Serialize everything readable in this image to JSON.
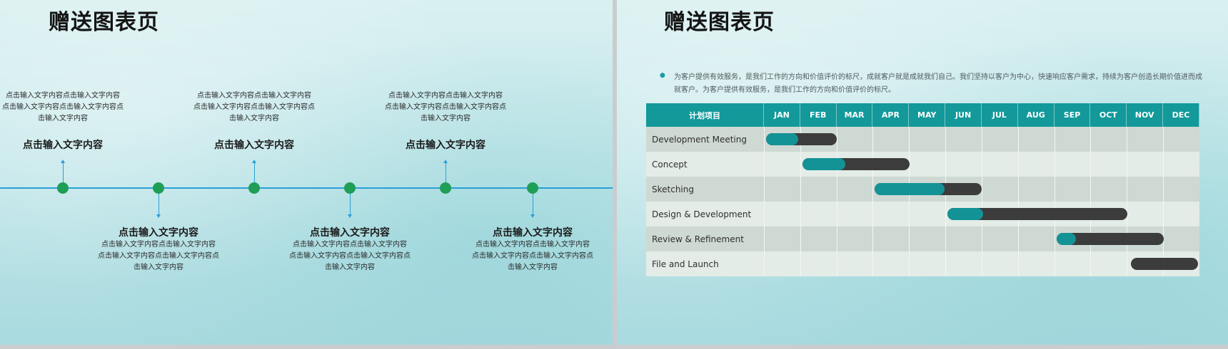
{
  "left_slide": {
    "title": "赠送图表页",
    "milestones": [
      {
        "heading": "点击输入文字内容",
        "desc": [
          "点击输入文字内容点击输入文字内容",
          "点击输入文字内容点击输入文字内容点",
          "击输入文字内容"
        ],
        "side": "top"
      },
      {
        "heading": "点击输入文字内容",
        "desc": [
          "点击输入文字内容点击输入文字内容",
          "点击输入文字内容点击输入文字内容点",
          "击输入文字内容"
        ],
        "side": "bottom"
      },
      {
        "heading": "点击输入文字内容",
        "desc": [
          "点击输入文字内容点击输入文字内容",
          "点击输入文字内容点击输入文字内容点",
          "击输入文字内容"
        ],
        "side": "top"
      },
      {
        "heading": "点击输入文字内容",
        "desc": [
          "点击输入文字内容点击输入文字内容",
          "点击输入文字内容点击输入文字内容点",
          "击输入文字内容"
        ],
        "side": "bottom"
      },
      {
        "heading": "点击输入文字内容",
        "desc": [
          "点击输入文字内容点击输入文字内容",
          "点击输入文字内容点击输入文字内容点",
          "击输入文字内容"
        ],
        "side": "top"
      },
      {
        "heading": "点击输入文字内容",
        "desc": [
          "点击输入文字内容点击输入文字内容",
          "点击输入文字内容点击输入文字内容点",
          "击输入文字内容"
        ],
        "side": "bottom"
      }
    ],
    "colors": {
      "line": "#2a9fd6",
      "dot": "#1f9e55"
    }
  },
  "right_slide": {
    "title": "赠送图表页",
    "intro": "为客户提供有效服务，是我们工作的方向和价值评价的标尺，成就客户就是成就我们自己。我们坚持以客户为中心，快速响应客户需求，持续为客户创造长期价值进而成就客户。为客户提供有效服务，是我们工作的方向和价值评价的标尺。",
    "gantt": {
      "header_label": "计划项目",
      "months": [
        "JAN",
        "FEB",
        "MAR",
        "APR",
        "MAY",
        "JUN",
        "JUL",
        "AUG",
        "SEP",
        "OCT",
        "NOV",
        "DEC"
      ],
      "tasks": [
        {
          "name": "Development Meeting",
          "start": 0,
          "end": 1.95,
          "progress": 0.45
        },
        {
          "name": "Concept",
          "start": 1.0,
          "end": 3.95,
          "progress": 0.4
        },
        {
          "name": "Sketching",
          "start": 3.0,
          "end": 5.95,
          "progress": 0.65
        },
        {
          "name": "Design & Development",
          "start": 5.0,
          "end": 9.95,
          "progress": 0.2
        },
        {
          "name": "Review & Refinement",
          "start": 8.0,
          "end": 10.95,
          "progress": 0.18
        },
        {
          "name": "File and Launch",
          "start": 10.05,
          "end": 11.9,
          "progress": 0
        }
      ],
      "colors": {
        "header": "#13999a",
        "bar": "#3c3c3c",
        "progress": "#149396"
      }
    }
  }
}
